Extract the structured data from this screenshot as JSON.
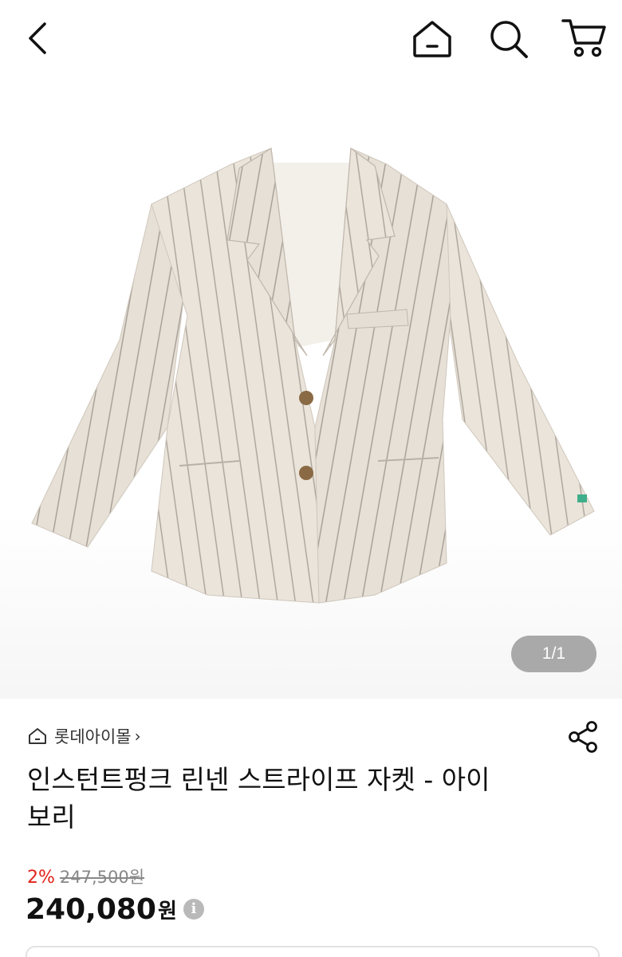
{
  "topbar": {
    "back_icon": "chevron-left-icon",
    "home_icon": "home-icon",
    "search_icon": "search-icon",
    "cart_icon": "cart-icon"
  },
  "gallery": {
    "page_indicator": "1/1",
    "image_colors": {
      "fabric": "#e9e2d8",
      "stripe": "#a9a29a",
      "lining": "#f4f0ea",
      "button": "#8a6a45"
    }
  },
  "product": {
    "store_icon": "home-outline-icon",
    "store_name": "롯데아이몰",
    "store_chevron": "›",
    "share_icon": "share-icon",
    "title_line1": "인스턴트펑크 린넨 스트라이프 자켓 - 아이",
    "title_line2": "보리",
    "discount": "2%",
    "original_price": "247,500원",
    "price": "240,080",
    "price_unit": "원",
    "info_icon": "i"
  },
  "colors": {
    "discount": "#e2231a",
    "text": "#111111",
    "muted": "#888888"
  }
}
